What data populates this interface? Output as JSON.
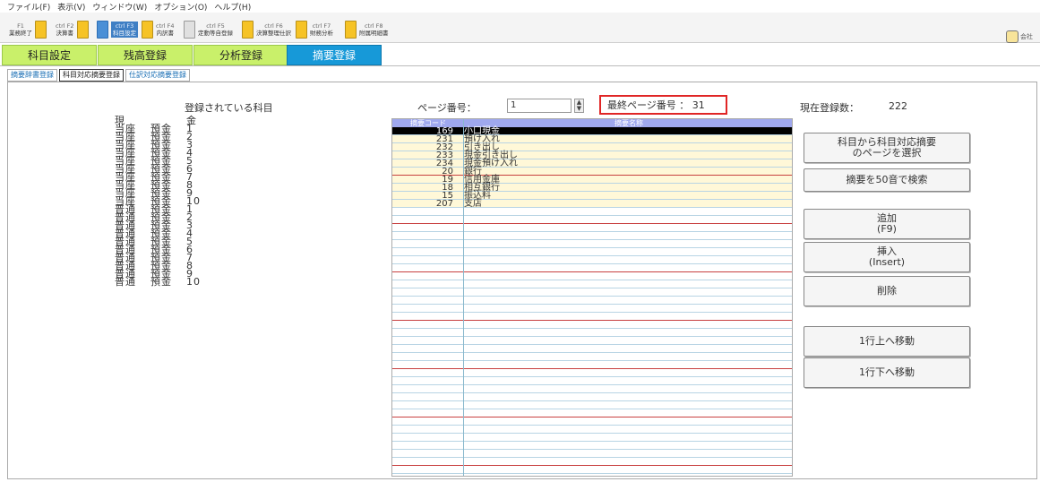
{
  "menu": [
    "ファイル(F)",
    "表示(V)",
    "ウィンドウ(W)",
    "オプション(O)",
    "ヘルプ(H)"
  ],
  "toolbar": [
    {
      "key": "F1",
      "label": "業務終了",
      "icon": "exit-icon"
    },
    {
      "key": "ctrl F2",
      "label": "決算書",
      "icon": "statement-icon"
    },
    {
      "key": "ctrl F3",
      "label": "科目設定",
      "icon": "subject-settings-icon",
      "active": true
    },
    {
      "key": "ctrl F4",
      "label": "内訳書",
      "icon": "breakdown-icon"
    },
    {
      "key": "ctrl F5",
      "label": "定動等自登録",
      "icon": "registration-icon"
    },
    {
      "key": "ctrl F6",
      "label": "決算整理仕訳",
      "icon": "journal-icon"
    },
    {
      "key": "ctrl F7",
      "label": "財務分析",
      "icon": "analysis-icon"
    },
    {
      "key": "ctrl F8",
      "label": "附属明細書",
      "icon": "schedule-icon"
    }
  ],
  "toolbar_right": "会社",
  "main_tabs": [
    "科目設定",
    "残高登録",
    "分析登録",
    "摘要登録"
  ],
  "sub_tabs": [
    "摘要辞書登録",
    "科目対応摘要登録",
    "仕訳対応摘要登録"
  ],
  "registered_subjects_label": "登録されている科目",
  "subjects": [
    {
      "name": "現",
      "kind": "",
      "num": "金"
    },
    {
      "name": "当座",
      "kind": "預金",
      "num": "1"
    },
    {
      "name": "当座",
      "kind": "預金",
      "num": "2"
    },
    {
      "name": "当座",
      "kind": "預金",
      "num": "3"
    },
    {
      "name": "当座",
      "kind": "預金",
      "num": "4"
    },
    {
      "name": "当座",
      "kind": "預金",
      "num": "5"
    },
    {
      "name": "当座",
      "kind": "預金",
      "num": "6"
    },
    {
      "name": "当座",
      "kind": "預金",
      "num": "7"
    },
    {
      "name": "当座",
      "kind": "預金",
      "num": "8"
    },
    {
      "name": "当座",
      "kind": "預金",
      "num": "9"
    },
    {
      "name": "当座",
      "kind": "預金",
      "num": "10"
    },
    {
      "name": "普通",
      "kind": "預金",
      "num": "1"
    },
    {
      "name": "普通",
      "kind": "預金",
      "num": "2"
    },
    {
      "name": "普通",
      "kind": "預金",
      "num": "3"
    },
    {
      "name": "普通",
      "kind": "預金",
      "num": "4"
    },
    {
      "name": "普通",
      "kind": "預金",
      "num": "5"
    },
    {
      "name": "普通",
      "kind": "預金",
      "num": "6"
    },
    {
      "name": "普通",
      "kind": "預金",
      "num": "7"
    },
    {
      "name": "普通",
      "kind": "預金",
      "num": "8"
    },
    {
      "name": "普通",
      "kind": "預金",
      "num": "9"
    },
    {
      "name": "普通",
      "kind": "預金",
      "num": "10"
    }
  ],
  "page_label": "ページ番号：",
  "page_value": "1",
  "last_page_label": "最終ページ番号 ： 31",
  "current_count_label": "現在登録数：",
  "current_count_value": "222",
  "grid": {
    "headers": [
      "摘要コード",
      "摘要名称"
    ],
    "rows": [
      {
        "code": "169",
        "name": "小口現金"
      },
      {
        "code": "231",
        "name": "預け入れ"
      },
      {
        "code": "232",
        "name": "引き出し"
      },
      {
        "code": "233",
        "name": "現金引き出し"
      },
      {
        "code": "234",
        "name": "現金預け入れ"
      },
      {
        "code": "20",
        "name": "銀行"
      },
      {
        "code": "19",
        "name": "信用金庫"
      },
      {
        "code": "18",
        "name": "相互銀行"
      },
      {
        "code": "15",
        "name": "振込料"
      },
      {
        "code": "207",
        "name": "支店"
      }
    ]
  },
  "buttons": {
    "select_by_subject": [
      "科目から科目対応摘要",
      "のページを選択"
    ],
    "search_50": "摘要を50音で検索",
    "add": [
      "追加",
      "(F9)"
    ],
    "insert": [
      "挿入",
      "(Insert)"
    ],
    "delete": "削除",
    "move_up": "1行上へ移動",
    "move_down": "1行下へ移動"
  },
  "colors": {
    "tab_green": "#c9f06a",
    "tab_active_blue": "#1799d8",
    "grid_header": "#9fa8ee",
    "highlight_red": "#e02626"
  }
}
